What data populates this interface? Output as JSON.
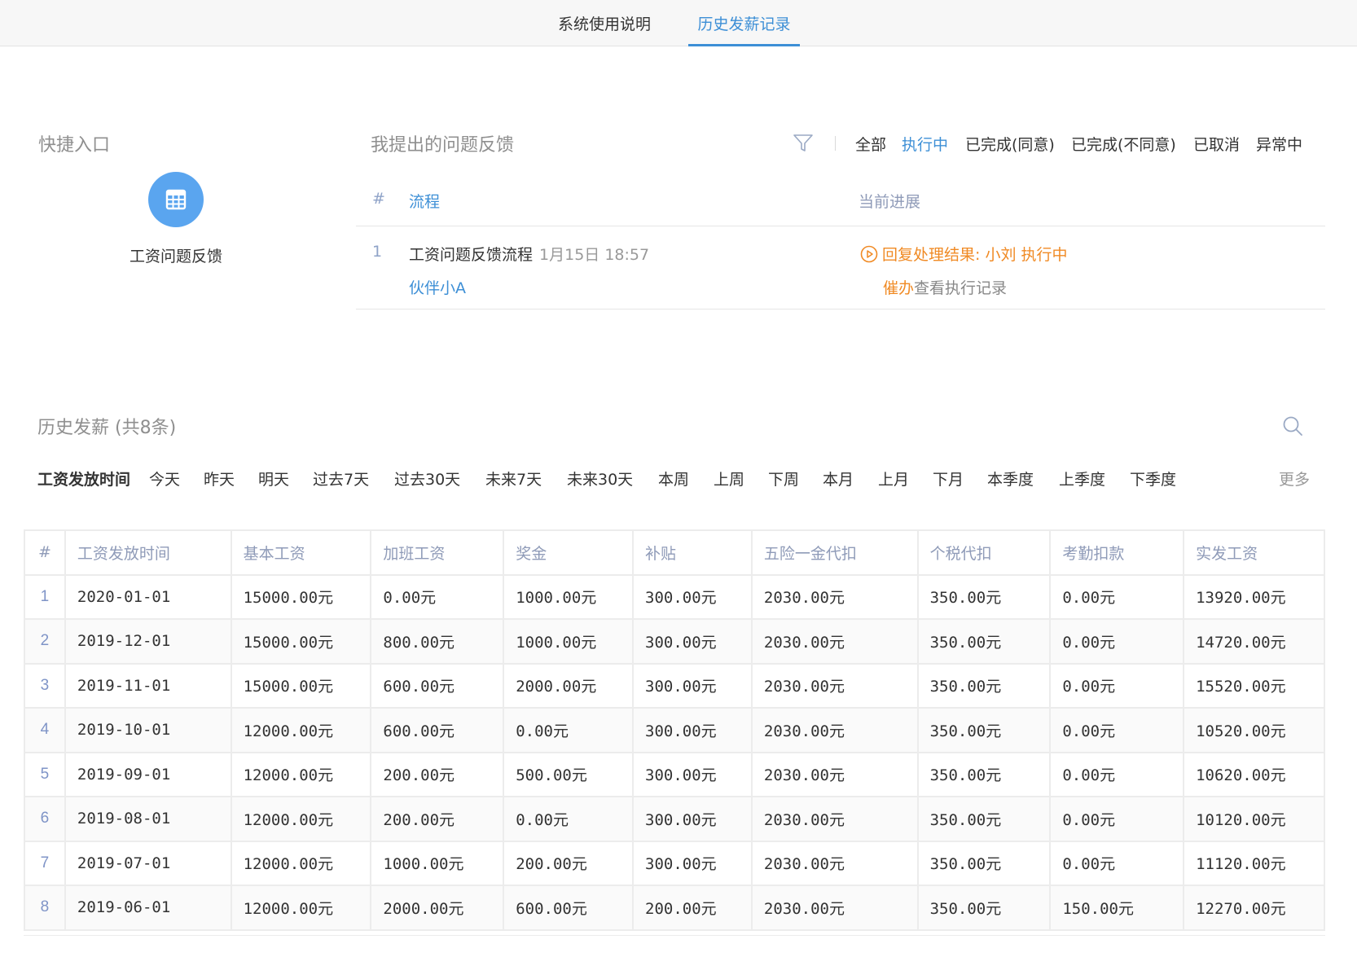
{
  "tabs": [
    {
      "label": "系统使用说明",
      "active": false
    },
    {
      "label": "历史发薪记录",
      "active": true
    }
  ],
  "quick_entry": {
    "title": "快捷入口",
    "items": [
      {
        "label": "工资问题反馈",
        "icon": "table-icon"
      }
    ]
  },
  "feedback": {
    "title": "我提出的问题反馈",
    "filters": [
      "全部",
      "执行中",
      "已完成(同意)",
      "已完成(不同意)",
      "已取消",
      "异常中"
    ],
    "active_filter": "执行中",
    "headers": {
      "index": "#",
      "flow": "流程",
      "progress": "当前进展"
    },
    "rows": [
      {
        "index": "1",
        "flow": "工资问题反馈流程",
        "time": "1月15日 18:57",
        "user": "伙伴小A",
        "status": "回复处理结果: 小刘 执行中",
        "urge": "催办",
        "log": "查看执行记录"
      }
    ]
  },
  "salary_history": {
    "title": "历史发薪 (共8条)",
    "filter_label": "工资发放时间",
    "filter_options": [
      "今天",
      "昨天",
      "明天",
      "过去7天",
      "过去30天",
      "未来7天",
      "未来30天",
      "本周",
      "上周",
      "下周",
      "本月",
      "上月",
      "下月",
      "本季度",
      "上季度",
      "下季度"
    ],
    "more": "更多",
    "columns": [
      "#",
      "工资发放时间",
      "基本工资",
      "加班工资",
      "奖金",
      "补贴",
      "五险一金代扣",
      "个税代扣",
      "考勤扣款",
      "实发工资"
    ],
    "rows": [
      [
        "1",
        "2020-01-01",
        "15000.00元",
        "0.00元",
        "1000.00元",
        "300.00元",
        "2030.00元",
        "350.00元",
        "0.00元",
        "13920.00元"
      ],
      [
        "2",
        "2019-12-01",
        "15000.00元",
        "800.00元",
        "1000.00元",
        "300.00元",
        "2030.00元",
        "350.00元",
        "0.00元",
        "14720.00元"
      ],
      [
        "3",
        "2019-11-01",
        "15000.00元",
        "600.00元",
        "2000.00元",
        "300.00元",
        "2030.00元",
        "350.00元",
        "0.00元",
        "15520.00元"
      ],
      [
        "4",
        "2019-10-01",
        "12000.00元",
        "600.00元",
        "0.00元",
        "300.00元",
        "2030.00元",
        "350.00元",
        "0.00元",
        "10520.00元"
      ],
      [
        "5",
        "2019-09-01",
        "12000.00元",
        "200.00元",
        "500.00元",
        "300.00元",
        "2030.00元",
        "350.00元",
        "0.00元",
        "10620.00元"
      ],
      [
        "6",
        "2019-08-01",
        "12000.00元",
        "200.00元",
        "0.00元",
        "300.00元",
        "2030.00元",
        "350.00元",
        "0.00元",
        "10120.00元"
      ],
      [
        "7",
        "2019-07-01",
        "12000.00元",
        "1000.00元",
        "200.00元",
        "300.00元",
        "2030.00元",
        "350.00元",
        "0.00元",
        "11120.00元"
      ],
      [
        "8",
        "2019-06-01",
        "12000.00元",
        "2000.00元",
        "600.00元",
        "200.00元",
        "2030.00元",
        "350.00元",
        "150.00元",
        "12270.00元"
      ]
    ]
  },
  "colors": {
    "accent": "#3d8fd6",
    "warning": "#f08a24",
    "icon_bg": "#5aa5ef",
    "muted": "#8f8f8f"
  }
}
